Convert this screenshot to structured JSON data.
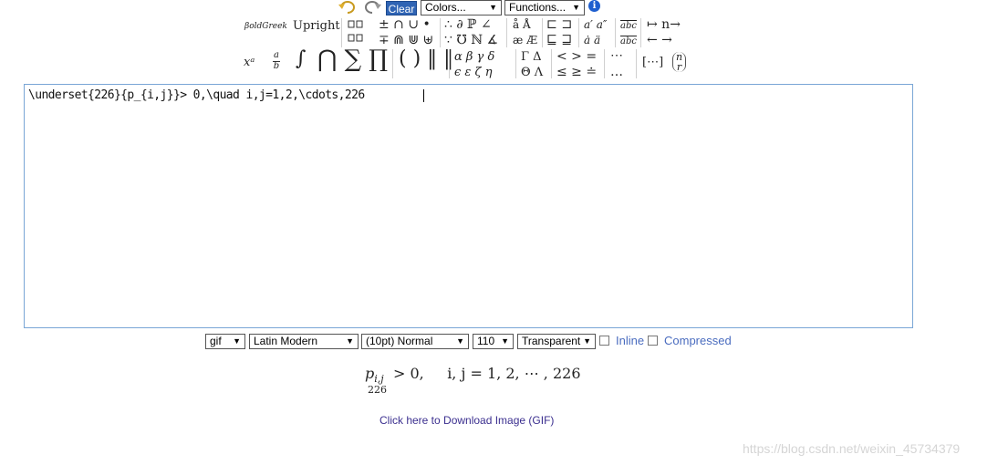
{
  "toolbar": {
    "undo_icon": "undo-icon",
    "redo_icon": "redo-icon",
    "clear_label": "Clear",
    "colors_label": "Colors...",
    "functions_label": "Functions...",
    "info_glyph": "i"
  },
  "palette": {
    "style_bold_greek": "βoldGreek",
    "style_upright": "Upright",
    "binops_1": "± ∩ ∪ •",
    "binops_2": "∓ ⋒ ⋓ ⊎",
    "logic_1": "∴ ∂ ℙ ∠",
    "logic_2": "∵ ℧ ℕ ∡",
    "accent_1": "å Å",
    "accent_2": "æ Æ",
    "subset_1": "⊏ ⊐",
    "subset_2": "⊑ ⊒",
    "prime_1": "a′ a″",
    "prime_2": "ȧ ä",
    "wide_1": "abc",
    "wide_2": "abc",
    "arrow_1": "↦  n→",
    "arrow_2": "← →",
    "sup": "xᵃ",
    "frac_num": "a",
    "frac_den": "b",
    "integral": "∫",
    "bigops": "⋂ ∑ ∏",
    "delims": "( ) ‖ ‖",
    "greek_1": "α β γ δ",
    "greek_2": "ϵ ε ζ η",
    "cgreek_1": "Γ Δ",
    "cgreek_2": "Θ Λ",
    "rel_1": "< > =",
    "rel_2": "≤ ≥ ≐",
    "dots_1": "⋯",
    "dots_2": "…",
    "matrix": "[⋯]",
    "binom_top": "n",
    "binom_bot": "r"
  },
  "editor": {
    "content": "\\underset{226}{p_{i,j}}> 0,\\quad i,j=1,2,\\cdots,226"
  },
  "options": {
    "format": "gif",
    "font": "Latin Modern",
    "size": "(10pt) Normal",
    "dpi": "110",
    "background": "Transparent",
    "inline_label": "Inline",
    "compressed_label": "Compressed"
  },
  "preview": {
    "main": "p",
    "sub": "i,j",
    "under": "226",
    "rest": "> 0,     i, j = 1, 2, ⋯ , 226"
  },
  "download_label": "Click here to Download Image (GIF)",
  "watermark": "https://blog.csdn.net/weixin_45734379"
}
